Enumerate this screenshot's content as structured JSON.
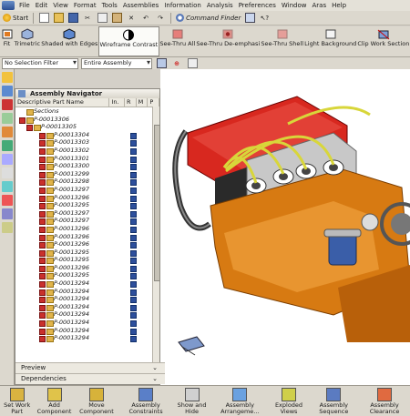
{
  "menubar": {
    "items": [
      "File",
      "Edit",
      "View",
      "Format",
      "Tools",
      "Assemblies",
      "Information",
      "Analysis",
      "Preferences",
      "Window",
      "Aras",
      "Help"
    ]
  },
  "toolbar1": {
    "start_label": "Start",
    "command_finder_label": "Command Finder"
  },
  "toolbar2": {
    "buttons": [
      {
        "label": "Fit",
        "icon": "fit-icon"
      },
      {
        "label": "Trimetric",
        "icon": "trimetric-icon"
      },
      {
        "label": "Shaded with Edges",
        "icon": "shaded-edges-icon"
      },
      {
        "label": "Wireframe Contrast",
        "icon": "wireframe-contrast-icon",
        "active": true
      },
      {
        "label": "See-Thru All",
        "icon": "see-thru-all-icon"
      },
      {
        "label": "See-Thru De-emphasi",
        "icon": "see-thru-deemphasis-icon"
      },
      {
        "label": "See-Thru Shell",
        "icon": "see-thru-shell-icon"
      },
      {
        "label": "Light Background",
        "icon": "light-background-icon"
      },
      {
        "label": "Clip Work Section",
        "icon": "clip-work-section-icon"
      }
    ]
  },
  "toolbar3": {
    "selection_filter": "No Selection Filter",
    "scope": "Entire Assembly"
  },
  "navigator": {
    "title": "Assembly Navigator",
    "columns": [
      "Descriptive Part Name",
      "In.",
      "R",
      "M",
      "P"
    ],
    "sections_label": "Sections",
    "root": "P-00013306",
    "sub": "P-00013305",
    "parts": [
      "P-00013304",
      "P-00013303",
      "P-00013302",
      "P-00013301",
      "P-00013300",
      "P-00013299",
      "P-00013298",
      "P-00013297",
      "P-00013296",
      "P-00013295",
      "P-00013297",
      "P-00013297",
      "P-00013296",
      "P-00013296",
      "P-00013296",
      "P-00013295",
      "P-00013295",
      "P-00013296",
      "P-00013295",
      "P-00013294",
      "P-00013294",
      "P-00013294",
      "P-00013294",
      "P-00013294",
      "P-00013294",
      "P-00013294",
      "P-00013294"
    ],
    "preview_label": "Preview",
    "dependencies_label": "Dependencies"
  },
  "bottom_toolbar": {
    "buttons": [
      {
        "label": "Set Work Part",
        "icon": "set-work-part-icon"
      },
      {
        "label": "Add Component",
        "icon": "add-component-icon"
      },
      {
        "label": "Move Component",
        "icon": "move-component-icon"
      },
      {
        "label": "Assembly Constraints",
        "icon": "assembly-constraints-icon"
      },
      {
        "label": "Show and Hide",
        "icon": "show-hide-icon"
      },
      {
        "label": "Assembly Arrangeme...",
        "icon": "assembly-arrangement-icon"
      },
      {
        "label": "Exploded Views",
        "icon": "exploded-views-icon"
      },
      {
        "label": "Assembly Sequence",
        "icon": "assembly-sequence-icon"
      },
      {
        "label": "Assembly Clearance",
        "icon": "assembly-clearance-icon"
      }
    ]
  },
  "colors": {
    "engine_orange": "#d77a12",
    "valve_cover_red": "#d8281f",
    "wire_yellow": "#d8d63a"
  }
}
